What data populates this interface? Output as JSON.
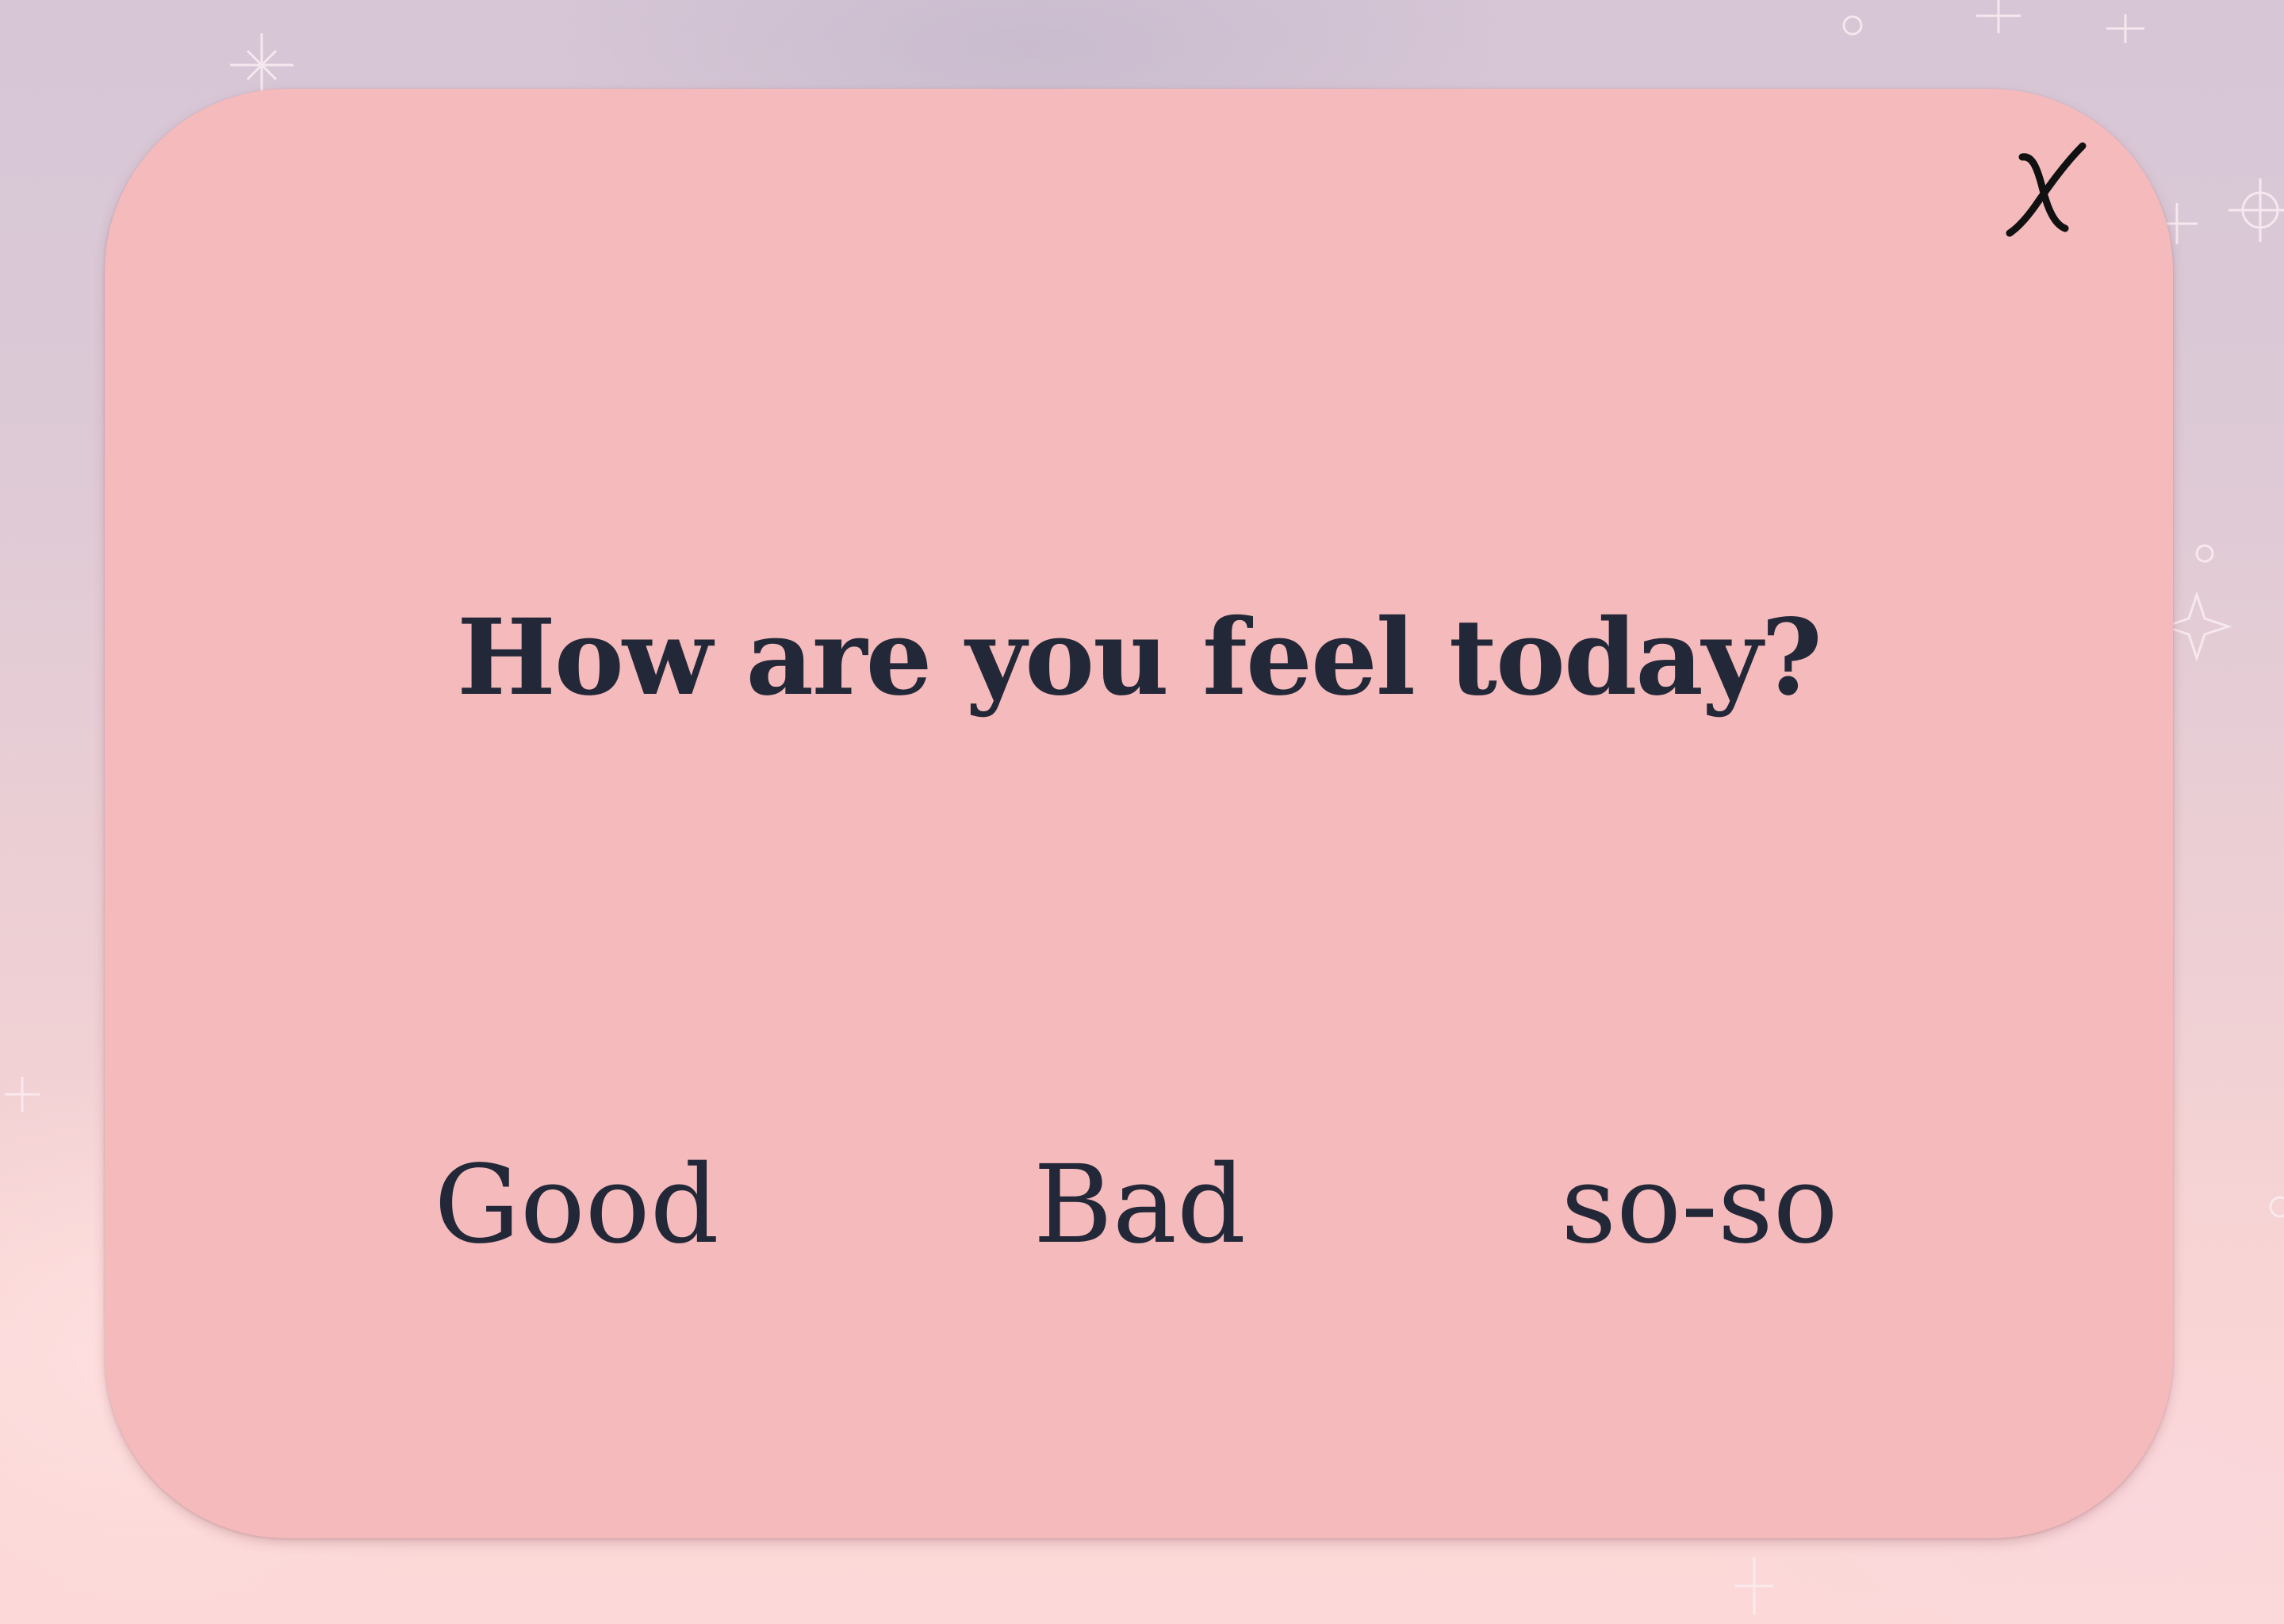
{
  "dialog": {
    "question": "How are you feel today?",
    "close_label": "close",
    "options": [
      {
        "label": "Good"
      },
      {
        "label": "Bad"
      },
      {
        "label": "so-so"
      }
    ]
  },
  "colors": {
    "card_background": "#f4babc",
    "text": "#232838",
    "close_icon": "#111111"
  },
  "icons": {
    "close": "close-icon"
  }
}
